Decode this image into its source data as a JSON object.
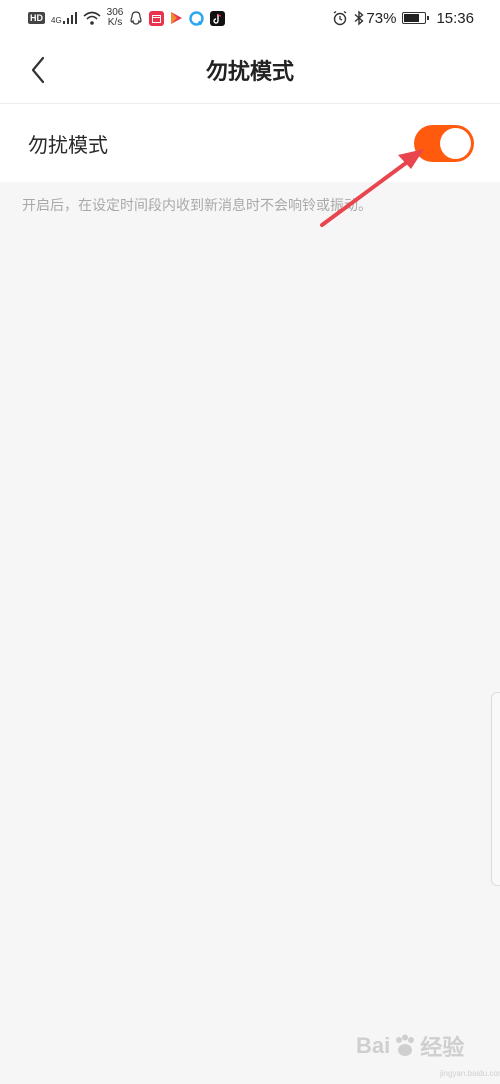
{
  "status_bar": {
    "hd_badge": "HD",
    "network_gen": "4G",
    "speed_value": "306",
    "speed_unit": "K/s",
    "battery_percent": "73%",
    "battery_level": 0.73,
    "time": "15:36"
  },
  "nav": {
    "title": "勿扰模式",
    "back_icon": "chevron-left-icon"
  },
  "setting": {
    "label": "勿扰模式",
    "toggle_on": true,
    "toggle_color": "#ff5a0e",
    "description": "开启后，在设定时间段内收到新消息时不会响铃或振动。"
  },
  "watermark": {
    "brand": "Bai",
    "suffix": "经验",
    "url": "jingyan.baidu.com"
  }
}
